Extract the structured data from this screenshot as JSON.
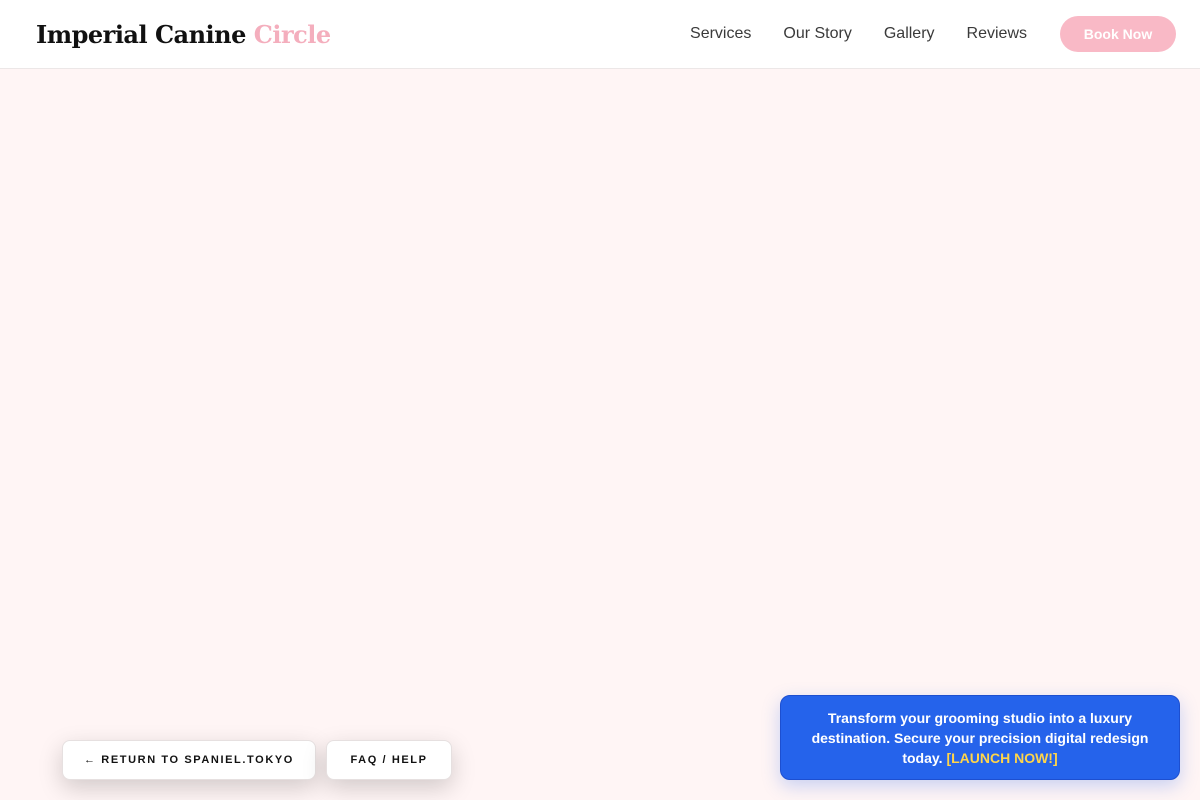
{
  "header": {
    "logo_main": "Imperial Canine",
    "logo_accent": "Circle",
    "nav": [
      {
        "label": "Services"
      },
      {
        "label": "Our Story"
      },
      {
        "label": "Gallery"
      },
      {
        "label": "Reviews"
      }
    ],
    "book_label": "Book Now"
  },
  "footer_actions": {
    "return_label": "← RETURN TO SPANIEL.TOKYO",
    "faq_label": "FAQ / HELP"
  },
  "promo": {
    "text": "Transform your grooming studio into a luxury destination. Secure your precision digital redesign today.",
    "cta": "[LAUNCH NOW!]"
  },
  "colors": {
    "page_background": "#fff5f5",
    "accent_pink": "#f4aebd",
    "book_button": "#f9b9c6",
    "promo_blue": "#2563eb",
    "promo_cta": "#ffd54a"
  }
}
